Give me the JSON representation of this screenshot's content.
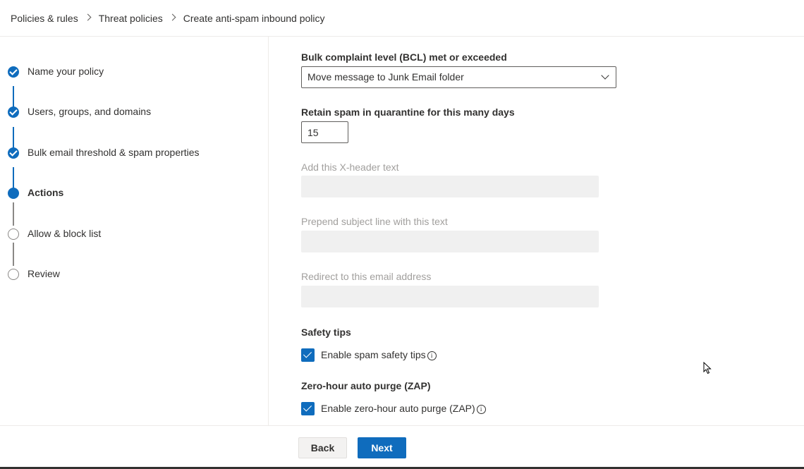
{
  "breadcrumb": {
    "items": [
      "Policies & rules",
      "Threat policies",
      "Create anti-spam inbound policy"
    ]
  },
  "steps": [
    {
      "label": "Name your policy",
      "state": "done"
    },
    {
      "label": "Users, groups, and domains",
      "state": "done"
    },
    {
      "label": "Bulk email threshold & spam properties",
      "state": "done"
    },
    {
      "label": "Actions",
      "state": "current"
    },
    {
      "label": "Allow & block list",
      "state": "todo"
    },
    {
      "label": "Review",
      "state": "todo"
    }
  ],
  "form": {
    "bcl_label": "Bulk complaint level (BCL) met or exceeded",
    "bcl_value": "Move message to Junk Email folder",
    "retain_label": "Retain spam in quarantine for this many days",
    "retain_value": "15",
    "xheader_label": "Add this X-header text",
    "prepend_label": "Prepend subject line with this text",
    "redirect_label": "Redirect to this email address",
    "safety_title": "Safety tips",
    "safety_checkbox_label": "Enable spam safety tips",
    "zap_title": "Zero-hour auto purge (ZAP)",
    "zap_checkbox_label": "Enable zero-hour auto purge (ZAP)"
  },
  "footer": {
    "back_label": "Back",
    "next_label": "Next"
  },
  "colors": {
    "accent": "#0f6cbd",
    "disabled_fill": "#f0f0f0"
  }
}
